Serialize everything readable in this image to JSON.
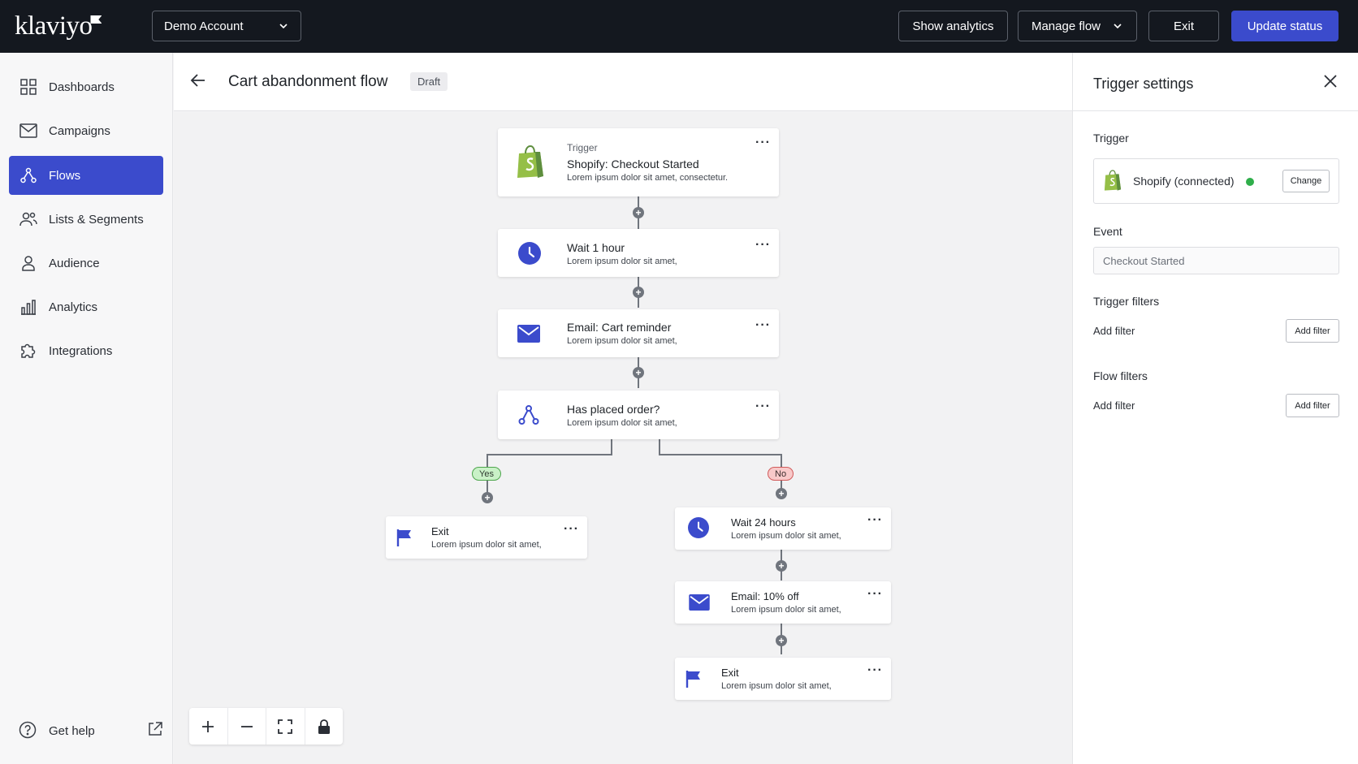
{
  "topbar": {
    "logo": "klaviyo",
    "account_label": "Demo Account",
    "show_analytics": "Show analytics",
    "manage_flow": "Manage flow",
    "exit": "Exit",
    "update_status": "Update status"
  },
  "sidebar": {
    "items": [
      {
        "label": "Dashboards",
        "icon": "grid-icon"
      },
      {
        "label": "Campaigns",
        "icon": "envelope-icon"
      },
      {
        "label": "Flows",
        "icon": "flow-icon",
        "active": true
      },
      {
        "label": "Lists & Segments",
        "icon": "users-icon"
      },
      {
        "label": "Audience",
        "icon": "person-icon"
      },
      {
        "label": "Analytics",
        "icon": "bar-chart-icon"
      },
      {
        "label": "Integrations",
        "icon": "puzzle-icon"
      }
    ],
    "help": "Get help"
  },
  "canvas_header": {
    "title": "Cart abandonment flow",
    "badge": "Draft"
  },
  "flow": {
    "trigger": {
      "label": "Trigger",
      "title": "Shopify: Checkout Started",
      "sub": "Lorem ipsum dolor sit amet, consectetur."
    },
    "wait1": {
      "title": "Wait 1 hour",
      "sub": "Lorem ipsum dolor sit amet,"
    },
    "email1": {
      "title": "Email: Cart reminder",
      "sub": "Lorem ipsum dolor sit amet,"
    },
    "split": {
      "title": "Has placed order?",
      "sub": "Lorem ipsum dolor sit amet,"
    },
    "yes_label": "Yes",
    "no_label": "No",
    "exit_yes": {
      "title": "Exit",
      "sub": "Lorem ipsum dolor sit amet,"
    },
    "wait2": {
      "title": "Wait 24 hours",
      "sub": "Lorem ipsum dolor sit amet,"
    },
    "email2": {
      "title": "Email: 10% off",
      "sub": "Lorem ipsum dolor sit amet,"
    },
    "exit_no": {
      "title": "Exit",
      "sub": "Lorem ipsum dolor sit amet,"
    }
  },
  "panel": {
    "title": "Trigger settings",
    "trigger_label": "Trigger",
    "trigger_value": "Shopify (connected)",
    "change": "Change",
    "event_label": "Event",
    "event_placeholder": "Checkout Started",
    "trigger_filters_label": "Trigger filters",
    "flow_filters_label": "Flow filters",
    "add_filter_text": "Add filter",
    "add_filter_btn": "Add filter"
  },
  "colors": {
    "accent": "#3b4bcc",
    "topbar": "#14181f",
    "shopify_green": "#95bf47",
    "connected_dot": "#2fae4a"
  }
}
